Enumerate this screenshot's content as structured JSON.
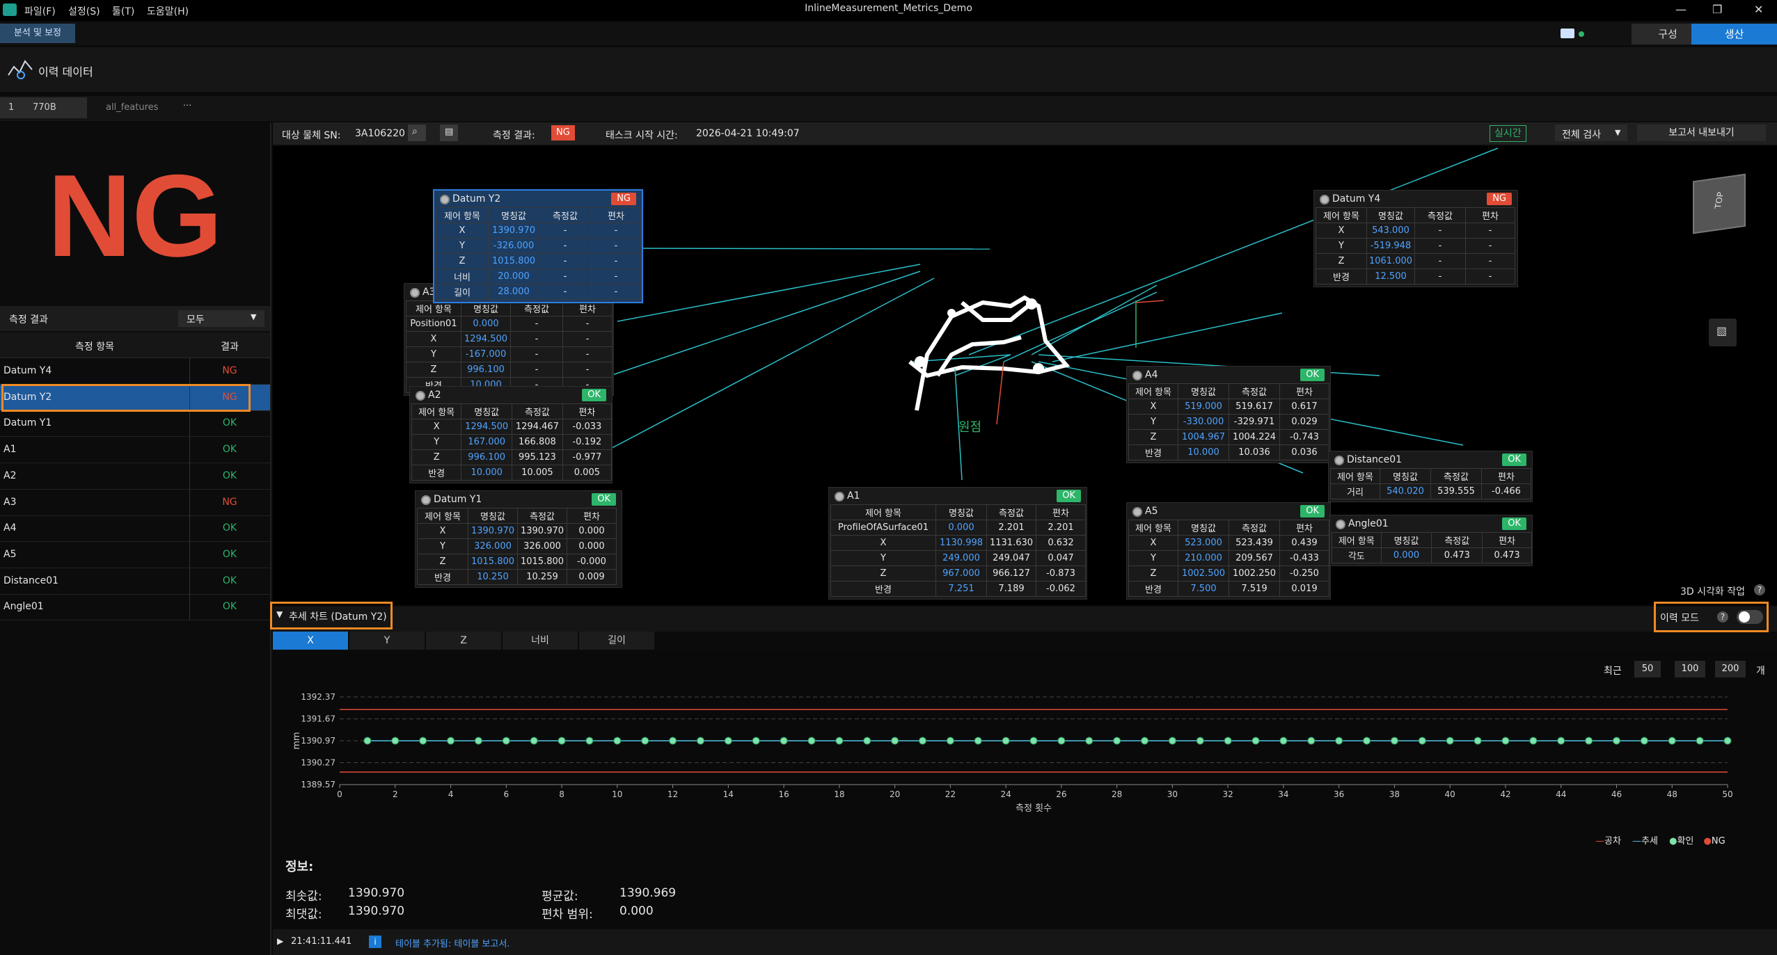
{
  "window": {
    "title": "InlineMeasurement_Metrics_Demo",
    "menus": [
      "파일(F)",
      "설정(S)",
      "툴(T)",
      "도움말(H)"
    ]
  },
  "top_tabs": {
    "analysis": "분석 및 보정",
    "config": "구성",
    "production": "생산"
  },
  "history": {
    "title": "이력 데이터"
  },
  "doc_tabs": {
    "index": "1",
    "name": "770B",
    "features": "all_features",
    "more": "···"
  },
  "left": {
    "status": "NG",
    "filter_label": "측정 결과",
    "filter_value": "모두",
    "col_item": "측정 항목",
    "col_result": "결과",
    "rows": [
      {
        "name": "Datum Y4",
        "result": "NG"
      },
      {
        "name": "Datum Y2",
        "result": "NG"
      },
      {
        "name": "Datum Y1",
        "result": "OK"
      },
      {
        "name": "A1",
        "result": "OK"
      },
      {
        "name": "A2",
        "result": "OK"
      },
      {
        "name": "A3",
        "result": "NG"
      },
      {
        "name": "A4",
        "result": "OK"
      },
      {
        "name": "A5",
        "result": "OK"
      },
      {
        "name": "Distance01",
        "result": "OK"
      },
      {
        "name": "Angle01",
        "result": "OK"
      }
    ]
  },
  "infobar": {
    "sn_label": "대상 물체 SN:",
    "sn": "3A106220",
    "result_label": "측정 결과:",
    "result": "NG",
    "time_label": "태스크 시작 시간:",
    "time": "2026-04-21 10:49:07",
    "realtime": "실시간",
    "full_check": "전체 검사",
    "export": "보고서 내보내기"
  },
  "viewport": {
    "origin_label": "원점",
    "viz_task": "3D 시각화 작업",
    "cube_label": "TOP"
  },
  "cards": {
    "headers": [
      "제어 항목",
      "명칭값",
      "측정값",
      "편차"
    ],
    "datum_y2": {
      "title": "Datum Y2",
      "status": "NG",
      "rows": [
        [
          "X",
          "1390.970",
          "-",
          "-"
        ],
        [
          "Y",
          "-326.000",
          "-",
          "-"
        ],
        [
          "Z",
          "1015.800",
          "-",
          "-"
        ],
        [
          "너비",
          "20.000",
          "-",
          "-"
        ],
        [
          "길이",
          "28.000",
          "-",
          "-"
        ]
      ]
    },
    "a3": {
      "title": "A3",
      "rows": [
        [
          "Position01",
          "0.000",
          "-",
          "-"
        ],
        [
          "X",
          "1294.500",
          "-",
          "-"
        ],
        [
          "Y",
          "-167.000",
          "-",
          "-"
        ],
        [
          "Z",
          "996.100",
          "-",
          "-"
        ],
        [
          "반경",
          "10.000",
          "-",
          "-"
        ]
      ]
    },
    "a2": {
      "title": "A2",
      "status": "OK",
      "rows": [
        [
          "X",
          "1294.500",
          "1294.467",
          "-0.033"
        ],
        [
          "Y",
          "167.000",
          "166.808",
          "-0.192"
        ],
        [
          "Z",
          "996.100",
          "995.123",
          "-0.977"
        ],
        [
          "반경",
          "10.000",
          "10.005",
          "0.005"
        ]
      ]
    },
    "datum_y1": {
      "title": "Datum Y1",
      "status": "OK",
      "rows": [
        [
          "X",
          "1390.970",
          "1390.970",
          "0.000"
        ],
        [
          "Y",
          "326.000",
          "326.000",
          "0.000"
        ],
        [
          "Z",
          "1015.800",
          "1015.800",
          "-0.000"
        ],
        [
          "반경",
          "10.250",
          "10.259",
          "0.009"
        ]
      ]
    },
    "a1": {
      "title": "A1",
      "status": "OK",
      "rows": [
        [
          "ProfileOfASurface01",
          "0.000",
          "2.201",
          "2.201"
        ],
        [
          "X",
          "1130.998",
          "1131.630",
          "0.632"
        ],
        [
          "Y",
          "249.000",
          "249.047",
          "0.047"
        ],
        [
          "Z",
          "967.000",
          "966.127",
          "-0.873"
        ],
        [
          "반경",
          "7.251",
          "7.189",
          "-0.062"
        ]
      ]
    },
    "datum_y4": {
      "title": "Datum Y4",
      "status": "NG",
      "rows": [
        [
          "X",
          "543.000",
          "-",
          "-"
        ],
        [
          "Y",
          "-519.948",
          "-",
          "-"
        ],
        [
          "Z",
          "1061.000",
          "-",
          "-"
        ],
        [
          "반경",
          "12.500",
          "-",
          "-"
        ]
      ]
    },
    "a4": {
      "title": "A4",
      "status": "OK",
      "rows": [
        [
          "X",
          "519.000",
          "519.617",
          "0.617"
        ],
        [
          "Y",
          "-330.000",
          "-329.971",
          "0.029"
        ],
        [
          "Z",
          "1004.967",
          "1004.224",
          "-0.743"
        ],
        [
          "반경",
          "10.000",
          "10.036",
          "0.036"
        ]
      ]
    },
    "a5": {
      "title": "A5",
      "status": "OK",
      "rows": [
        [
          "X",
          "523.000",
          "523.439",
          "0.439"
        ],
        [
          "Y",
          "210.000",
          "209.567",
          "-0.433"
        ],
        [
          "Z",
          "1002.500",
          "1002.250",
          "-0.250"
        ],
        [
          "반경",
          "7.500",
          "7.519",
          "0.019"
        ]
      ]
    },
    "distance01": {
      "title": "Distance01",
      "status": "OK",
      "rows": [
        [
          "거리",
          "540.020",
          "539.555",
          "-0.466"
        ]
      ]
    },
    "angle01": {
      "title": "Angle01",
      "status": "OK",
      "rows": [
        [
          "각도",
          "0.000",
          "0.473",
          "0.473"
        ]
      ]
    }
  },
  "trend": {
    "title": "추세 차트 (Datum Y2)",
    "history_mode": "이력 모드",
    "tabs": [
      "X",
      "Y",
      "Z",
      "너비",
      "길이"
    ],
    "recent_label": "최근",
    "recent_options": [
      "50",
      "100",
      "200"
    ],
    "recent_unit": "개",
    "legend": [
      "공차",
      "추세",
      "확인",
      "NG"
    ]
  },
  "chart_data": {
    "type": "line",
    "xlabel": "측정 횟수",
    "ylabel": "mm",
    "xlim": [
      0,
      50
    ],
    "ylim": [
      1389.57,
      1392.37
    ],
    "y_ticks": [
      "1392.37",
      "1391.67",
      "1390.97",
      "1390.27",
      "1389.57"
    ],
    "x_ticks": [
      0,
      2,
      4,
      6,
      8,
      10,
      12,
      14,
      16,
      18,
      20,
      22,
      24,
      26,
      28,
      30,
      32,
      34,
      36,
      38,
      40,
      42,
      44,
      46,
      48,
      50
    ],
    "tolerance_upper": 1391.97,
    "tolerance_lower": 1389.97,
    "series": [
      {
        "name": "확인",
        "x": [
          1,
          2,
          3,
          4,
          5,
          6,
          7,
          8,
          9,
          10,
          11,
          12,
          13,
          14,
          15,
          16,
          17,
          18,
          19,
          20,
          21,
          22,
          23,
          24,
          25,
          26,
          27,
          28,
          29,
          30,
          31,
          32,
          33,
          34,
          35,
          36,
          37,
          38,
          39,
          40,
          41,
          42,
          43,
          44,
          45,
          46,
          47,
          48,
          49,
          50
        ],
        "values": [
          1390.97,
          1390.97,
          1390.97,
          1390.97,
          1390.97,
          1390.97,
          1390.97,
          1390.97,
          1390.97,
          1390.97,
          1390.97,
          1390.97,
          1390.97,
          1390.97,
          1390.97,
          1390.97,
          1390.97,
          1390.97,
          1390.97,
          1390.97,
          1390.97,
          1390.97,
          1390.97,
          1390.97,
          1390.97,
          1390.97,
          1390.97,
          1390.97,
          1390.97,
          1390.97,
          1390.97,
          1390.97,
          1390.97,
          1390.97,
          1390.97,
          1390.97,
          1390.97,
          1390.97,
          1390.97,
          1390.97,
          1390.97,
          1390.97,
          1390.97,
          1390.97,
          1390.97,
          1390.97,
          1390.97,
          1390.97,
          1390.97,
          1390.97
        ]
      }
    ],
    "colors": {
      "tolerance": "#e14c36",
      "trend": "#4fc3e8",
      "ok": "#7de3a8",
      "ng": "#e14c36"
    }
  },
  "info": {
    "title": "정보:",
    "min_label": "최솟값:",
    "min": "1390.970",
    "max_label": "최댓값:",
    "max": "1390.970",
    "avg_label": "평균값:",
    "avg": "1390.969",
    "range_label": "편차 범위:",
    "range": "0.000"
  },
  "status": {
    "time": "21:41:11.441",
    "message": "테이블 추가됨: 테이블 보고서."
  }
}
